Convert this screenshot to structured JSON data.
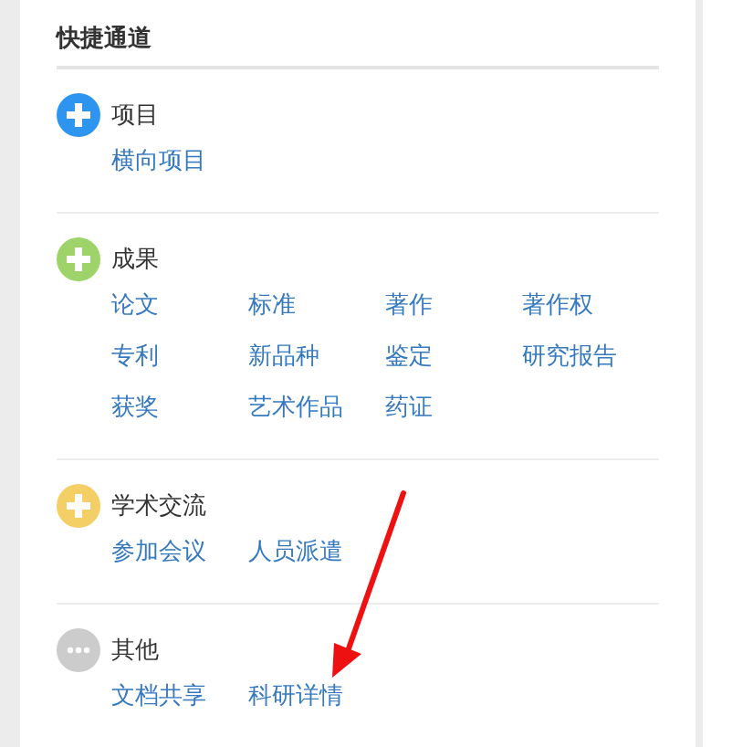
{
  "panel": {
    "title": "快捷通道"
  },
  "sections": [
    {
      "label": "项目",
      "kind": "plus",
      "color": "#2d95f0",
      "links": [
        "横向项目"
      ]
    },
    {
      "label": "成果",
      "kind": "plus",
      "color": "#9ed36a",
      "links": [
        "论文",
        "标准",
        "著作",
        "著作权",
        "专利",
        "新品种",
        "鉴定",
        "研究报告",
        "获奖",
        "艺术作品",
        "药证"
      ]
    },
    {
      "label": "学术交流",
      "kind": "plus",
      "color": "#f3cf66",
      "links": [
        "参加会议",
        "人员派遣"
      ]
    },
    {
      "label": "其他",
      "kind": "more",
      "color": "#cccccc",
      "links": [
        "文档共享",
        "科研详情"
      ]
    }
  ]
}
